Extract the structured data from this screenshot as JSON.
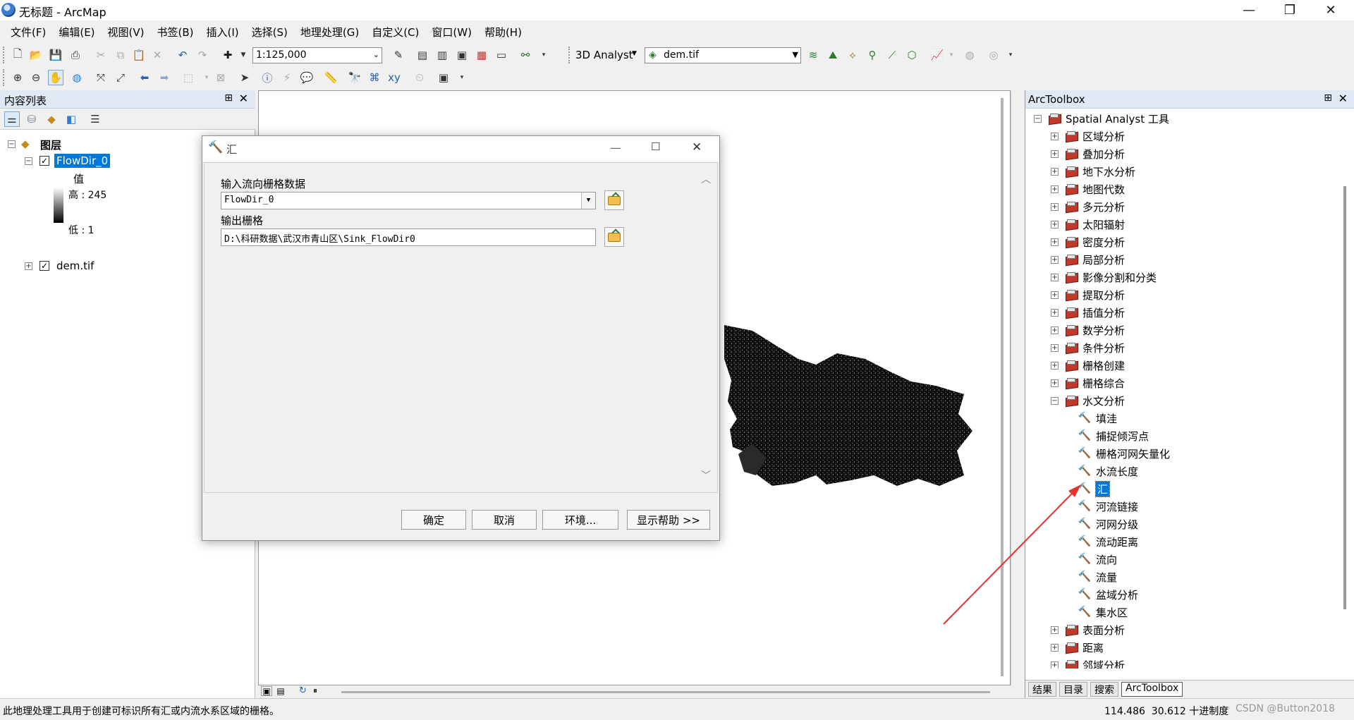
{
  "window": {
    "title": "无标题 - ArcMap",
    "minimize": "—",
    "restore": "❐",
    "close": "✕"
  },
  "menu": [
    "文件(F)",
    "编辑(E)",
    "视图(V)",
    "书签(B)",
    "插入(I)",
    "选择(S)",
    "地理处理(G)",
    "自定义(C)",
    "窗口(W)",
    "帮助(H)"
  ],
  "toolbar": {
    "scale": "1:125,000",
    "analyst_label": "3D Analyst",
    "layer_combo": "dem.tif"
  },
  "toc": {
    "title": "内容列表",
    "pin": "⊞",
    "close": "✕",
    "root_label": "图层",
    "layer1": {
      "name": "FlowDir_0",
      "value_label": "值",
      "high_label": "高 : 245",
      "low_label": "低 : 1"
    },
    "layer2": {
      "name": "dem.tif"
    }
  },
  "arctoolbox": {
    "title": "ArcToolbox",
    "root": "Spatial Analyst 工具",
    "toolsets_before": [
      "区域分析",
      "叠加分析",
      "地下水分析",
      "地图代数",
      "多元分析",
      "太阳辐射",
      "密度分析",
      "局部分析",
      "影像分割和分类",
      "提取分析",
      "插值分析",
      "数学分析",
      "条件分析",
      "栅格创建",
      "栅格综合"
    ],
    "expanded_toolset": "水文分析",
    "tools": [
      "填洼",
      "捕捉倾泻点",
      "栅格河网矢量化",
      "水流长度",
      "汇",
      "河流链接",
      "河网分级",
      "流动距离",
      "流向",
      "流量",
      "盆域分析",
      "集水区"
    ],
    "selected_tool_index": 4,
    "toolsets_after": [
      "表面分析",
      "距离",
      "邻域分析"
    ],
    "tabs": [
      "结果",
      "目录",
      "搜索",
      "ArcToolbox"
    ]
  },
  "dialog": {
    "title": "汇",
    "input_label": "输入流向栅格数据",
    "input_value": "FlowDir_0",
    "output_label": "输出栅格",
    "output_value": "D:\\科研数据\\武汉市青山区\\Sink_FlowDir0",
    "buttons": {
      "ok": "确定",
      "cancel": "取消",
      "env": "环境...",
      "help": "显示帮助 >>"
    }
  },
  "status": {
    "message": "此地理处理工具用于创建可标识所有汇或内流水系区域的栅格。",
    "coords": "114.486  30.612 十进制度",
    "watermark": "CSDN @Button2018"
  },
  "colors": {
    "accent": "#0078d7",
    "annotation_arrow": "#e8312f",
    "toolbox_red": "#c0392b"
  }
}
